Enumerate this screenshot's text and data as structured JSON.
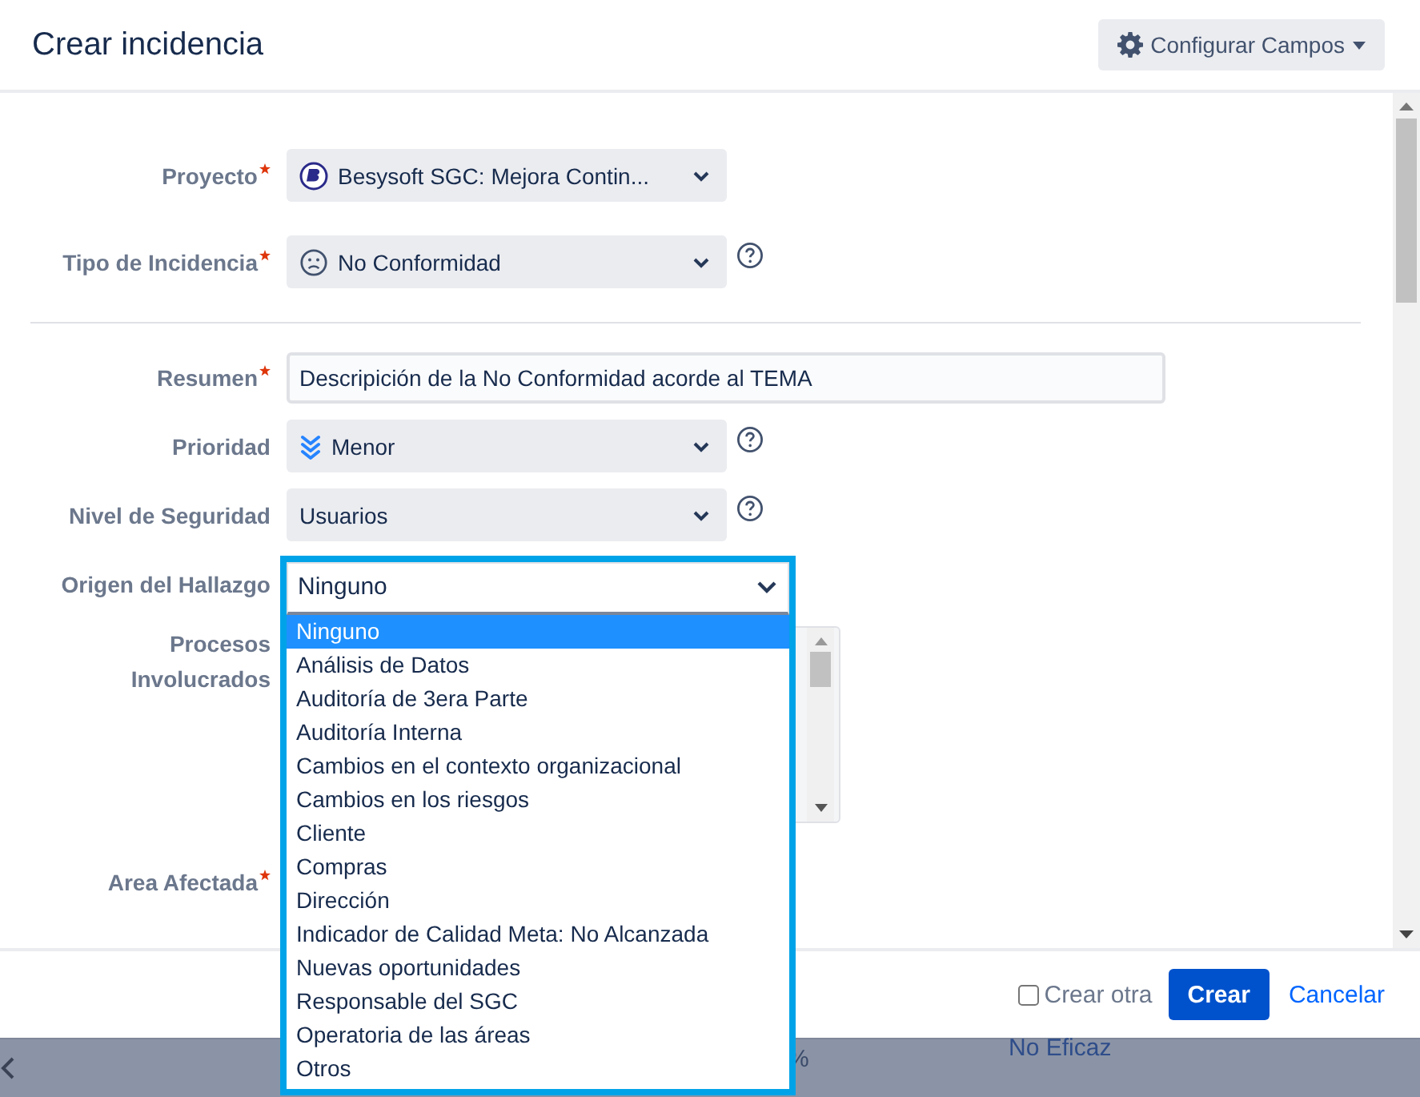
{
  "dialog": {
    "title": "Crear incidencia",
    "configure_button": "Configurar Campos"
  },
  "sections": [
    {
      "fields": [
        {
          "kind": "select",
          "label": "Proyecto",
          "required": true,
          "value": "Besysoft SGC: Mejora Contin...",
          "help": false
        },
        {
          "kind": "select",
          "label": "Tipo de Incidencia",
          "required": true,
          "value": "No Conformidad",
          "help": true
        }
      ]
    },
    {
      "fields": [
        {
          "kind": "text",
          "label": "Resumen",
          "required": true,
          "value": "Descripición de la No Conformidad acorde al TEMA",
          "help": false
        },
        {
          "kind": "select",
          "label": "Prioridad",
          "required": false,
          "value": "Menor",
          "help": true
        },
        {
          "kind": "select",
          "label": "Nivel de Seguridad",
          "required": false,
          "value": "Usuarios",
          "help": true
        },
        {
          "kind": "dropdown",
          "label": "Origen del Hallazgo",
          "required": false,
          "value": "Ninguno",
          "help": false,
          "options": [
            {
              "label": "Ninguno",
              "selected": true
            },
            {
              "label": "Análisis de Datos",
              "selected": false
            },
            {
              "label": "Auditoría de 3era Parte",
              "selected": false
            },
            {
              "label": "Auditoría Interna",
              "selected": false
            },
            {
              "label": "Cambios en el contexto organizacional",
              "selected": false
            },
            {
              "label": "Cambios en los riesgos",
              "selected": false
            },
            {
              "label": "Cliente",
              "selected": false
            },
            {
              "label": "Compras",
              "selected": false
            },
            {
              "label": "Dirección",
              "selected": false
            },
            {
              "label": "Indicador de Calidad Meta: No Alcanzada",
              "selected": false
            },
            {
              "label": "Nuevas oportunidades",
              "selected": false
            },
            {
              "label": "Responsable del SGC",
              "selected": false
            },
            {
              "label": "Operatoria de las áreas",
              "selected": false
            },
            {
              "label": "Otros",
              "selected": false
            }
          ]
        },
        {
          "kind": "listbox",
          "label": "Procesos Involucrados",
          "required": false,
          "help": false
        },
        {
          "kind": "empty",
          "label": "Area Afectada",
          "required": true,
          "help": false
        }
      ]
    }
  ],
  "footer": {
    "create_another": {
      "label": "Crear otra",
      "checked": false
    },
    "create_button": "Crear",
    "cancel_link": "Cancelar"
  },
  "background": {
    "texts": [
      "%",
      "No Eficaz"
    ]
  }
}
